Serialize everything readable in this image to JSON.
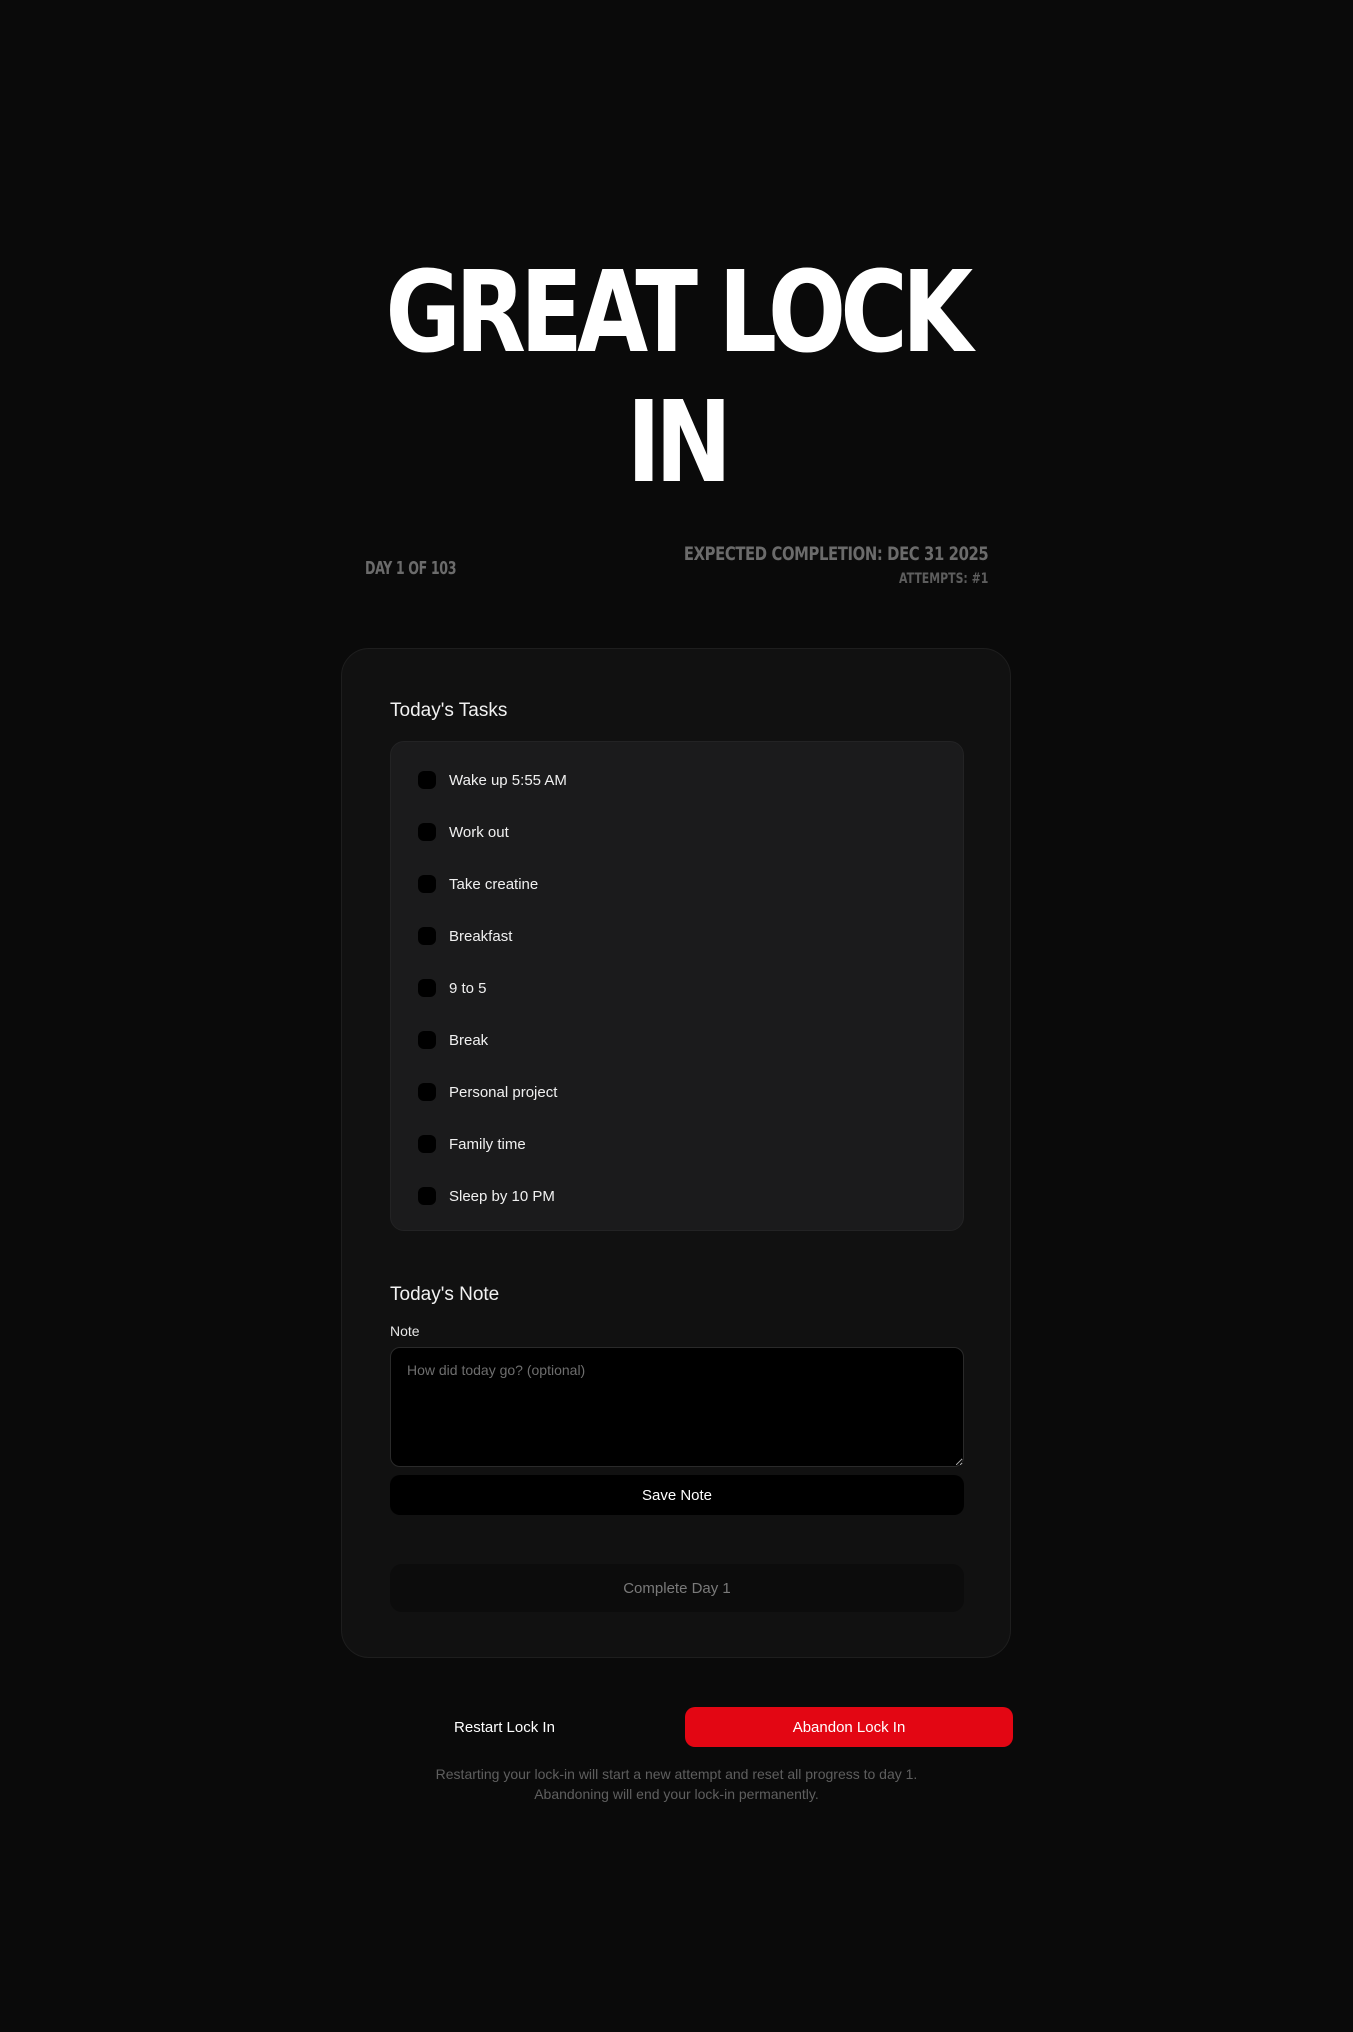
{
  "hero": {
    "title_line1": "GREAT LOCK",
    "title_line2": "IN"
  },
  "meta": {
    "day": "DAY 1 OF 103",
    "expected_completion": "EXPECTED COMPLETION: DEC 31 2025",
    "attempts": "ATTEMPTS: #1"
  },
  "tasks": {
    "title": "Today's Tasks",
    "items": [
      {
        "label": "Wake up 5:55 AM",
        "checked": false
      },
      {
        "label": "Work out",
        "checked": false
      },
      {
        "label": "Take creatine",
        "checked": false
      },
      {
        "label": "Breakfast",
        "checked": false
      },
      {
        "label": "9 to 5",
        "checked": false
      },
      {
        "label": "Break",
        "checked": false
      },
      {
        "label": "Personal project",
        "checked": false
      },
      {
        "label": "Family time",
        "checked": false
      },
      {
        "label": "Sleep by 10 PM",
        "checked": false
      }
    ]
  },
  "note": {
    "title": "Today's Note",
    "label": "Note",
    "value": "",
    "placeholder": "How did today go? (optional)",
    "save_label": "Save Note"
  },
  "complete": {
    "label": "Complete Day 1"
  },
  "actions": {
    "restart_label": "Restart Lock In",
    "abandon_label": "Abandon Lock In"
  },
  "footnote": {
    "line1": "Restarting your lock-in will start a new attempt and reset all progress to day 1.",
    "line2": "Abandoning will end your lock-in permanently."
  },
  "colors": {
    "background": "#0a0a0a",
    "card": "#111111",
    "tasks_panel": "#1b1b1c",
    "danger": "#e30613"
  }
}
